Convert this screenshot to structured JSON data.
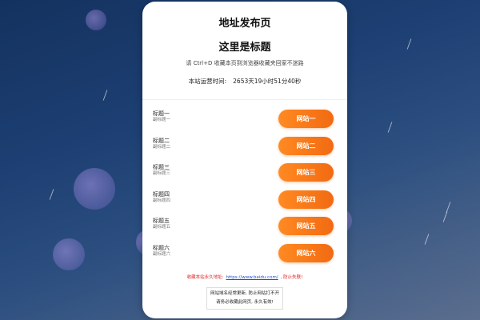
{
  "header": {
    "page_title": "地址发布页",
    "main_title": "这里是标题",
    "hint": "请 Ctrl+D 收藏本页到浏览器收藏夹回家不迷路",
    "uptime_label": "本站运营时间:",
    "uptime_value": "2653天19小时51分40秒"
  },
  "sites": [
    {
      "title": "标题一",
      "subtitle": "副标题一",
      "button": "网站一"
    },
    {
      "title": "标题二",
      "subtitle": "副标题二",
      "button": "网站二"
    },
    {
      "title": "标题三",
      "subtitle": "副标题三",
      "button": "网站三"
    },
    {
      "title": "标题四",
      "subtitle": "副标题四",
      "button": "网站四"
    },
    {
      "title": "标题五",
      "subtitle": "副标题五",
      "button": "网站五"
    },
    {
      "title": "标题六",
      "subtitle": "副标题六",
      "button": "网站六"
    }
  ],
  "footer": {
    "notice_prefix": "收藏本站永久地址:",
    "link": "https://www.baidu.com/",
    "notice_suffix": ", 防止失联!",
    "line1": "网站域名经常更新, 防止网站打不开",
    "line2": "请务必收藏此网页, 永久有效!"
  },
  "colors": {
    "button_start": "#ff8a22",
    "button_end": "#f26a12",
    "notice": "#e02020",
    "link": "#1a4fd8"
  }
}
